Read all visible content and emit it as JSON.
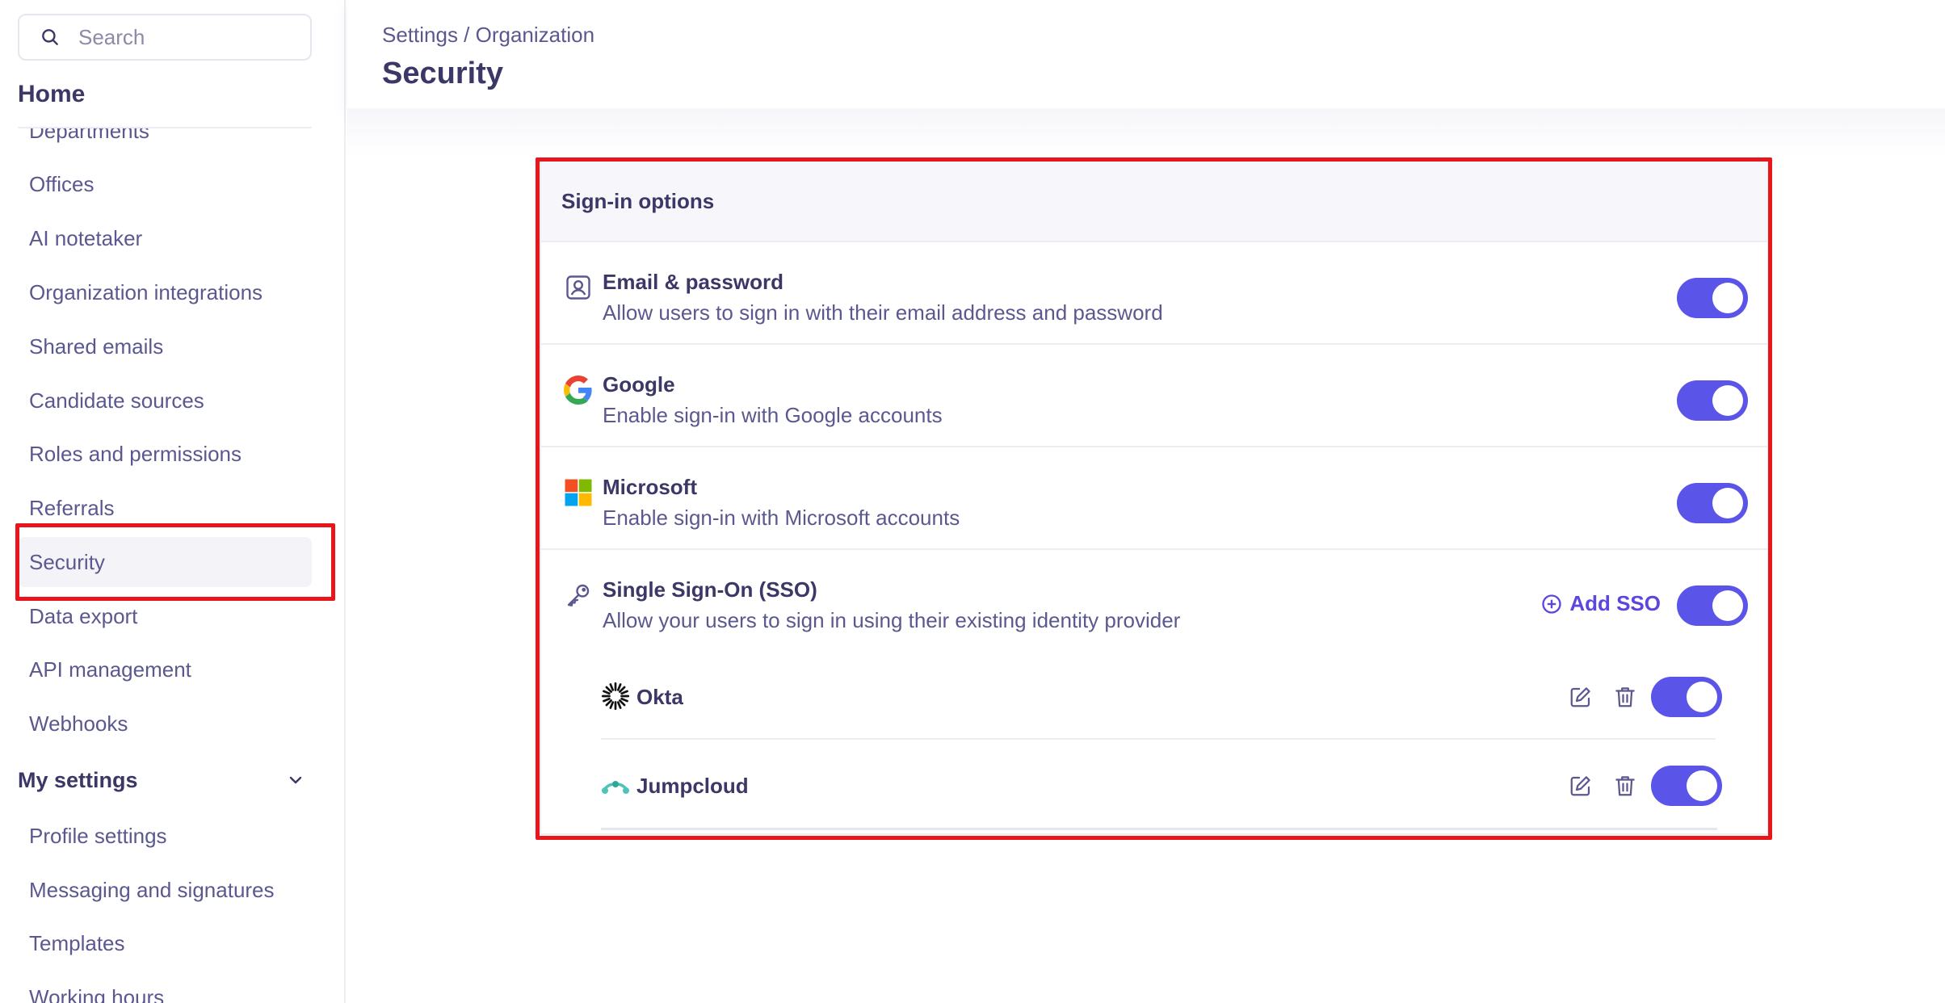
{
  "search": {
    "placeholder": "Search"
  },
  "sidebar": {
    "home_label": "Home",
    "partial_top_label": "Departments",
    "items": [
      {
        "label": "Offices"
      },
      {
        "label": "AI notetaker"
      },
      {
        "label": "Organization integrations"
      },
      {
        "label": "Shared emails"
      },
      {
        "label": "Candidate sources"
      },
      {
        "label": "Roles and permissions"
      },
      {
        "label": "Referrals"
      },
      {
        "label": "Security",
        "active": true
      },
      {
        "label": "Data export"
      },
      {
        "label": "API management"
      },
      {
        "label": "Webhooks"
      }
    ],
    "my_settings": {
      "label": "My settings",
      "items": [
        {
          "label": "Profile settings"
        },
        {
          "label": "Messaging and signatures"
        },
        {
          "label": "Templates"
        },
        {
          "label": "Working hours"
        }
      ]
    }
  },
  "header": {
    "breadcrumb": "Settings / Organization",
    "title": "Security"
  },
  "signin": {
    "heading": "Sign-in options",
    "options": [
      {
        "title": "Email & password",
        "description": "Allow users to sign in with their email address and password",
        "icon": "user-card-icon",
        "enabled": true
      },
      {
        "title": "Google",
        "description": "Enable sign-in with Google accounts",
        "icon": "google-logo-icon",
        "enabled": true
      },
      {
        "title": "Microsoft",
        "description": "Enable sign-in with Microsoft accounts",
        "icon": "microsoft-logo-icon",
        "enabled": true
      }
    ],
    "sso": {
      "title": "Single Sign-On (SSO)",
      "description": "Allow your users to sign in using their existing identity provider",
      "add_label": "Add SSO",
      "enabled": true,
      "providers": [
        {
          "name": "Okta",
          "icon": "okta-logo-icon",
          "enabled": true
        },
        {
          "name": "Jumpcloud",
          "icon": "jumpcloud-logo-icon",
          "enabled": true
        }
      ]
    }
  },
  "colors": {
    "accent": "#5b54e9",
    "highlight": "#e8151b",
    "text": "#3b3766",
    "muted": "#5b5890"
  }
}
